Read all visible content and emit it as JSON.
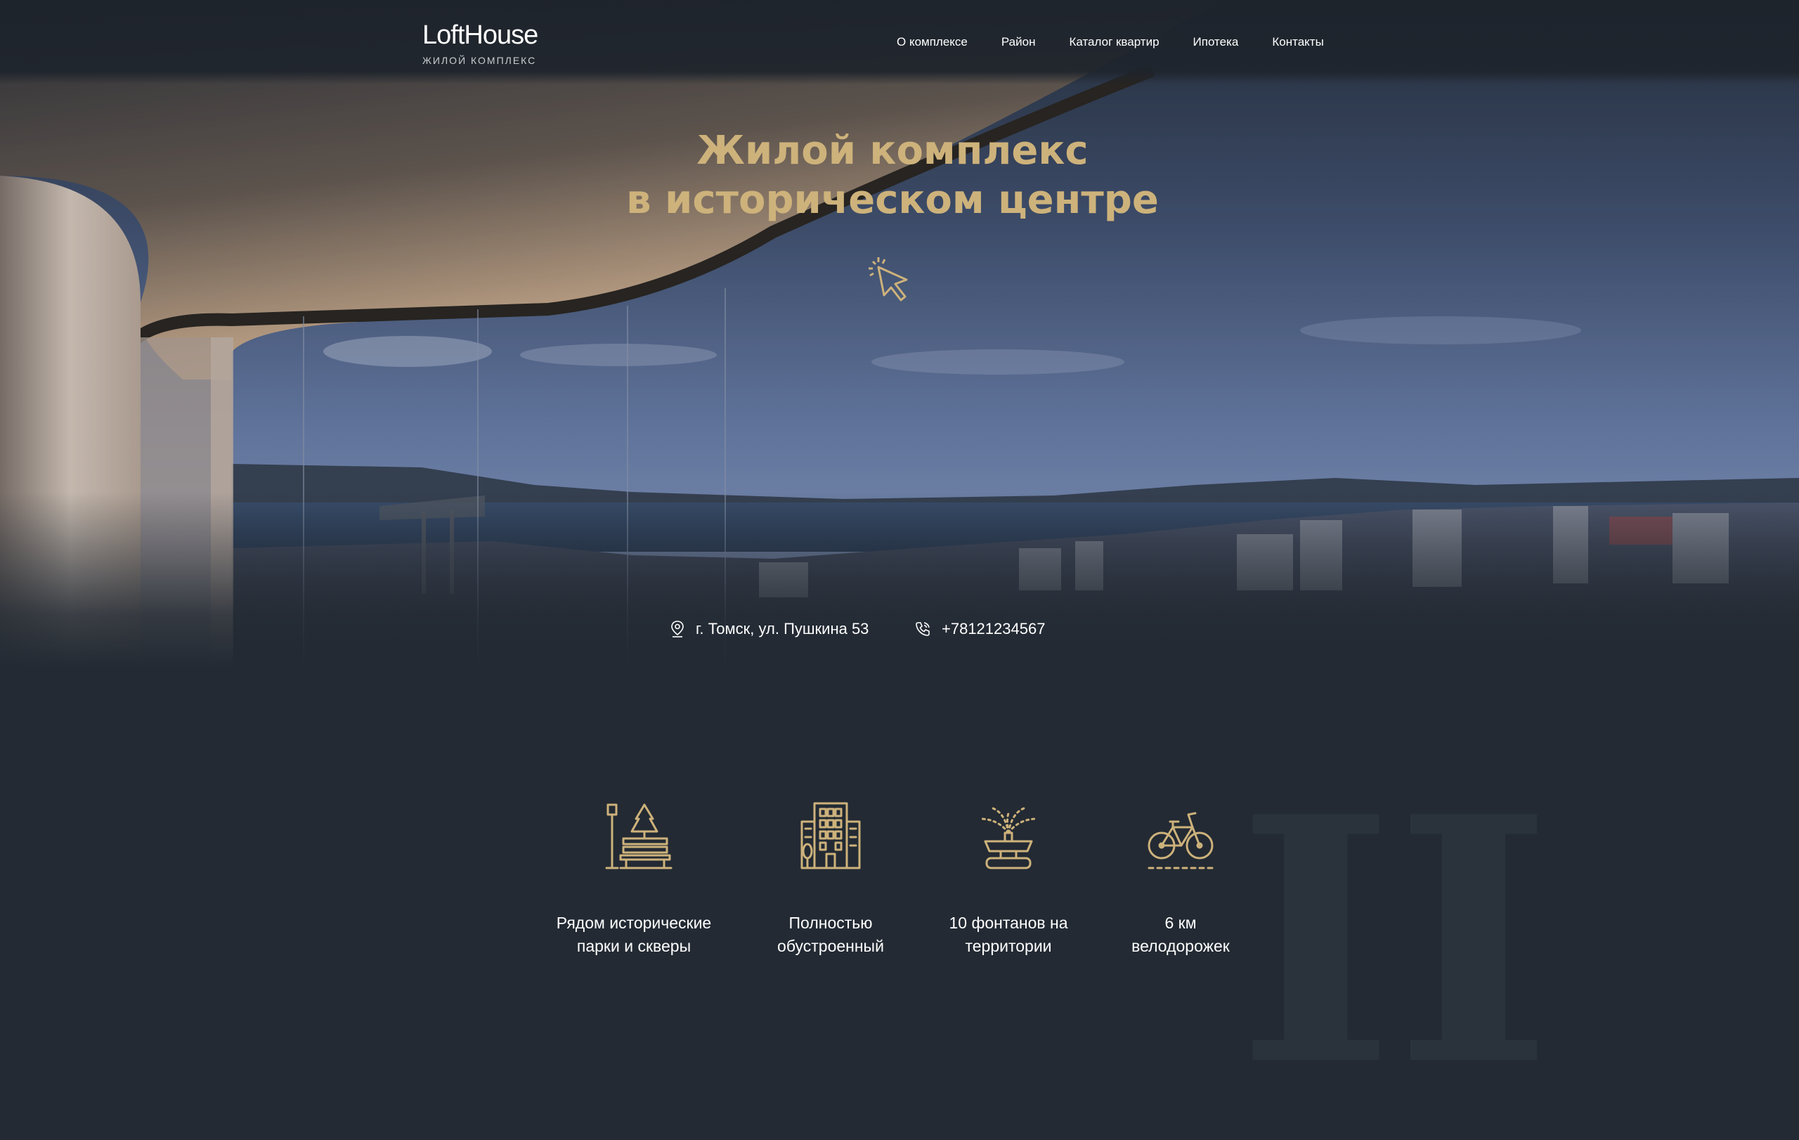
{
  "brand": {
    "name": "LoftHouse",
    "subtitle": "ЖИЛОЙ КОМПЛЕКС"
  },
  "nav": [
    "О комплексе",
    "Район",
    "Каталог квартир",
    "Ипотека",
    "Контакты"
  ],
  "hero": {
    "title_line1": "Жилой комплекс",
    "title_line2": "в историческом центре",
    "address": "г. Томск, ул. Пушкина 53",
    "phone": "+78121234567"
  },
  "features": [
    {
      "icon": "park-bench-icon",
      "line1": "Рядом исторические",
      "line2": "парки и скверы"
    },
    {
      "icon": "building-icon",
      "line1": "Полностью",
      "line2": "обустроенный"
    },
    {
      "icon": "fountain-icon",
      "line1": "10 фонтанов на",
      "line2": "территории"
    },
    {
      "icon": "bicycle-icon",
      "line1": "6 км",
      "line2": "велодорожек"
    }
  ],
  "colors": {
    "accent": "#cdb27b",
    "background": "#232a33",
    "text": "#ffffff"
  }
}
